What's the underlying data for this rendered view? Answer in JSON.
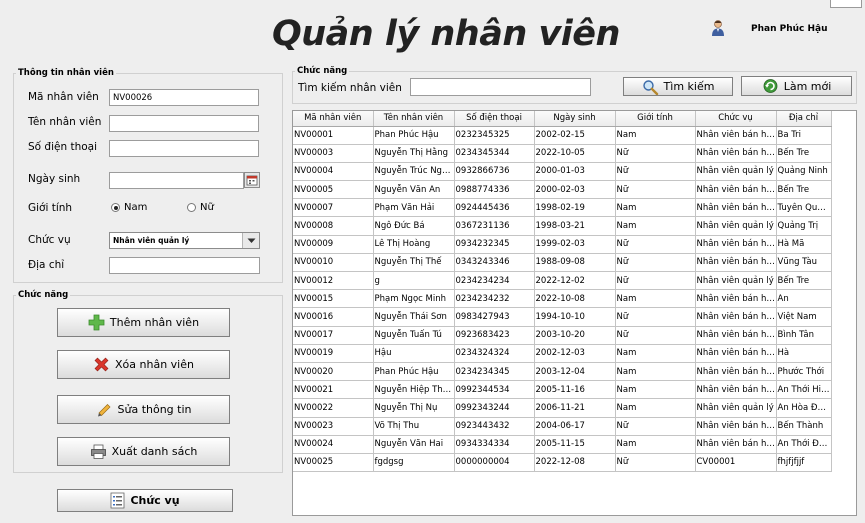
{
  "header": {
    "title": "Quản lý nhân viên",
    "user_name": "Phan Phúc Hậu"
  },
  "employee_info": {
    "legend": "Thông tin nhân viên",
    "id_label": "Mã nhân viên",
    "id_value": "NV00026",
    "name_label": "Tên nhân viên",
    "name_value": "",
    "phone_label": "Số điện thoại",
    "phone_value": "",
    "birthdate_label": "Ngày sinh",
    "birthdate_value": "",
    "gender_label": "Giới tính",
    "gender_options": [
      "Nam",
      "Nữ"
    ],
    "gender_selected": "Nam",
    "position_label": "Chức vụ",
    "position_value": "Nhân viên quản lý",
    "address_label": "Địa chỉ",
    "address_value": ""
  },
  "functions": {
    "legend": "Chức năng",
    "add_label": "Thêm nhân viên",
    "delete_label": "Xóa nhân viên",
    "edit_label": "Sửa thông tin",
    "export_label": "Xuất danh sách",
    "position_button_label": "Chức vụ"
  },
  "search": {
    "legend": "Chức năng",
    "label": "Tìm kiếm nhân viên",
    "value": "",
    "search_button": "Tìm kiếm",
    "refresh_button": "Làm mới"
  },
  "table": {
    "columns": [
      "Mã nhân viên",
      "Tên nhân viên",
      "Số điện thoại",
      "Ngày sinh",
      "Giới tính",
      "Chức vụ",
      "Địa chỉ"
    ],
    "rows": [
      [
        "NV00001",
        "Phan Phúc Hậu",
        "0232345325",
        "2002-02-15",
        "Nam",
        "Nhân viên bán hàng",
        "Ba Tri"
      ],
      [
        "NV00003",
        "Nguyễn Thị Hằng",
        "0234345344",
        "2022-10-05",
        "Nữ",
        "Nhân viên bán hàng",
        "Bến Tre"
      ],
      [
        "NV00004",
        "Nguyễn Trúc Nguy...",
        "0932866736",
        "2000-01-03",
        "Nữ",
        "Nhân viên quản lý",
        "Quảng Ninh"
      ],
      [
        "NV00005",
        "Nguyễn Văn An",
        "0988774336",
        "2000-02-03",
        "Nữ",
        "Nhân viên bán hàng",
        "Bến Tre"
      ],
      [
        "NV00007",
        "Phạm Văn Hải",
        "0924445436",
        "1998-02-19",
        "Nam",
        "Nhân viên bán hàng",
        "Tuyên Quang"
      ],
      [
        "NV00008",
        "Ngô Đức Bá",
        "0367231136",
        "1998-03-21",
        "Nam",
        "Nhân viên quản lý",
        "Quảng Trị"
      ],
      [
        "NV00009",
        "Lê Thị Hoàng",
        "0934232345",
        "1999-02-03",
        "Nữ",
        "Nhân viên bán hàng",
        "Hà Mã"
      ],
      [
        "NV00010",
        "Nguyễn Thị Thế",
        "0343243346",
        "1988-09-08",
        "Nữ",
        "Nhân viên bán hàng",
        "Vũng Tàu"
      ],
      [
        "NV00012",
        "g",
        "0234234234",
        "2022-12-02",
        "Nữ",
        "Nhân viên quản lý",
        "Bến Tre"
      ],
      [
        "NV00015",
        "Phạm Ngọc Minh",
        "0234234232",
        "2022-10-08",
        "Nam",
        "Nhân viên bán hàng",
        "An"
      ],
      [
        "NV00016",
        "Nguyễn Thái Sơn",
        "0983427943",
        "1994-10-10",
        "Nữ",
        "Nhân viên bán hàng",
        "Việt Nam"
      ],
      [
        "NV00017",
        "Nguyễn Tuấn Tú",
        "0923683423",
        "2003-10-20",
        "Nữ",
        "Nhân viên bán hàng",
        "Bình Tân"
      ],
      [
        "NV00019",
        "Hậu",
        "0234324324",
        "2002-12-03",
        "Nam",
        "Nhân viên bán hàng",
        "Hà"
      ],
      [
        "NV00020",
        "Phan Phúc Hậu",
        "0234234345",
        "2003-12-04",
        "Nam",
        "Nhân viên bán hàng",
        "Phước Thới"
      ],
      [
        "NV00021",
        "Nguyễn Hiệp Thành",
        "0992344534",
        "2005-11-16",
        "Nam",
        "Nhân viên bán hàng",
        "An Thới Hiệp"
      ],
      [
        "NV00022",
        "Nguyễn Thị Nụ",
        "0992343244",
        "2006-11-21",
        "Nam",
        "Nhân viên quản lý",
        "An Hòa Đông"
      ],
      [
        "NV00023",
        "Võ Thị Thu",
        "0923443432",
        "2004-06-17",
        "Nữ",
        "Nhân viên bán hàng",
        "Bến Thành"
      ],
      [
        "NV00024",
        "Nguyễn Văn Hai",
        "0934334334",
        "2005-11-15",
        "Nam",
        "Nhân viên bán hàng",
        "An Thới Đông"
      ],
      [
        "NV00025",
        "fgdgsg",
        "0000000004",
        "2022-12-08",
        "Nữ",
        "CV00001",
        "fhjfjfjjf"
      ]
    ]
  },
  "icons": {
    "user": "user-icon",
    "calendar": "calendar-icon",
    "add": "plus-icon",
    "delete": "x-icon",
    "edit": "pencil-icon",
    "export": "printer-icon",
    "position": "list-icon",
    "search": "magnifier-icon",
    "refresh": "refresh-icon"
  },
  "colors": {
    "background": "#eeeeee",
    "add_icon": "#5fb84a",
    "delete_icon": "#d9362b",
    "refresh_icon": "#3f9a3a"
  }
}
